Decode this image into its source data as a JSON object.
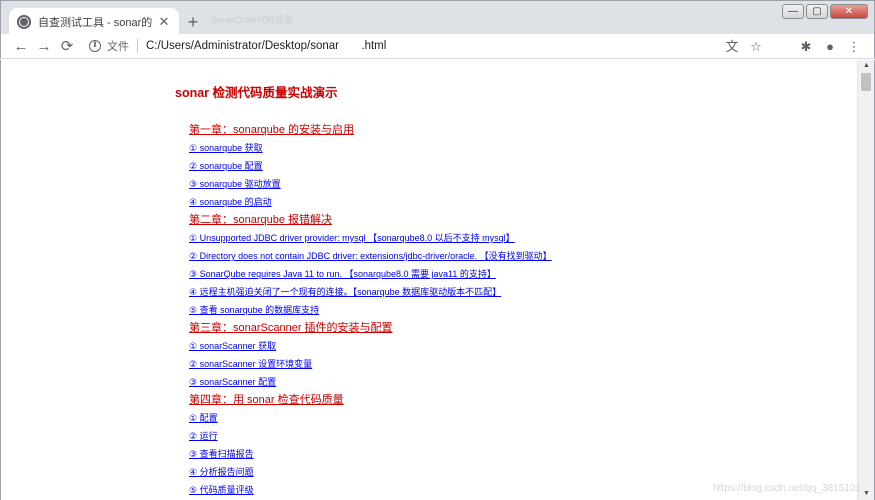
{
  "browser": {
    "tab_title": "自查测试工具 - sonar的安装 - 反",
    "tab_close": "✕",
    "new_tab": "+",
    "ghost_tab": "SonarQube代码质量",
    "window_controls": {
      "minimize": "—",
      "maximize": "▢",
      "close": "✕"
    },
    "nav": {
      "back": "←",
      "forward": "→",
      "reload": "⟳"
    },
    "scheme_label": "文件",
    "url": "C:/Users/Administrator/Desktop/sonar       .html",
    "actions": {
      "translate": "⽂",
      "bookmark": "☆",
      "extensions": "✱",
      "profile": "●",
      "menu": "⋮"
    }
  },
  "page": {
    "title": "sonar 检测代码质量实战演示",
    "chapters": [
      {
        "title": "第一章：sonarqube 的安装与启用",
        "items": [
          "① sonarqube 获取",
          "② sonarqube 配置",
          "③ sonarqube 驱动放置",
          "④ sonarqube 的启动"
        ]
      },
      {
        "title": "第二章：sonarqube 报错解决",
        "items": [
          "① Unsupported JDBC driver provider: mysql 【sonarqube8.0 以后不支持 mysql】",
          "② Directory does not contain JDBC driver: extensions/jdbc-driver/oracle. 【没有找到驱动】",
          "③ SonarQube requires Java 11 to run. 【sonarqube8.0 需要 java11 的支持】",
          "④ 远程主机强迫关闭了一个现有的连接。【sonarqube 数据库驱动版本不匹配】",
          "⑤ 查看 sonarqube 的数据库支持"
        ]
      },
      {
        "title": "第三章：sonarScanner 插件的安装与配置",
        "items": [
          "① sonarScanner 获取",
          "② sonarScanner 设置环境变量",
          "③ sonarScanner 配置"
        ]
      },
      {
        "title": "第四章：用 sonar 检查代码质量",
        "items": [
          "① 配置",
          "② 运行",
          "③ 查看扫描报告",
          "④ 分析报告问题",
          "⑤ 代码质量评级"
        ]
      }
    ]
  },
  "scrollbar": {
    "up": "▲",
    "down": "▼"
  },
  "watermark": "https://blog.csdn.net/qq_3815101"
}
